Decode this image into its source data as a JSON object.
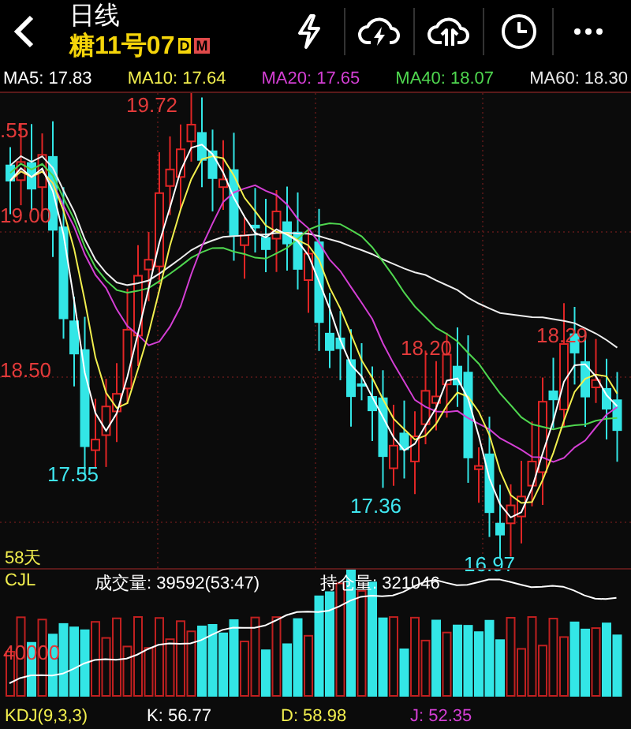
{
  "header": {
    "title": "日线",
    "symbol": "糖11号07",
    "badges": [
      {
        "text": "D",
        "color": "#f5d50a"
      },
      {
        "text": "M",
        "color": "#e04a4a"
      }
    ]
  },
  "toolbar": [
    {
      "kind": "flash"
    },
    {
      "kind": "cloud-flash"
    },
    {
      "kind": "cloud-upload"
    },
    {
      "kind": "clock"
    },
    {
      "kind": "more"
    }
  ],
  "ma_row": [
    {
      "text": "MA5: 17.83",
      "color": "#ffffff"
    },
    {
      "text": "MA10: 17.64",
      "color": "#f2ef4e"
    },
    {
      "text": "MA20: 17.65",
      "color": "#d43fd4"
    },
    {
      "text": "MA40: 18.07",
      "color": "#4fd64f"
    },
    {
      "text": "MA60: 18.30",
      "color": "#e8e8e8"
    }
  ],
  "price_axis": [
    {
      "text": ".55",
      "color": "#e23a3a"
    },
    {
      "text": "19.00",
      "color": "#e23a3a"
    },
    {
      "text": "18.50",
      "color": "#e23a3a"
    }
  ],
  "extremes": [
    {
      "text": "19.72",
      "kind": "high"
    },
    {
      "text": "17.55",
      "kind": "low"
    },
    {
      "text": "18.20",
      "kind": "high"
    },
    {
      "text": "17.36",
      "kind": "low"
    },
    {
      "text": "18.29",
      "kind": "high"
    },
    {
      "text": "16.97",
      "kind": "low"
    }
  ],
  "period": "58天",
  "volume_pane": {
    "name": "CJL",
    "volume": "成交量: 39592(53:47)",
    "open_interest": "持仓量: 321046",
    "axis_label": "40000"
  },
  "kdj": [
    {
      "text": "KDJ(9,3,3)",
      "color": "#f2ef4e"
    },
    {
      "text": "K: 56.77",
      "color": "#ffffff"
    },
    {
      "text": "D: 58.98",
      "color": "#f2ef4e"
    },
    {
      "text": "J: 52.35",
      "color": "#d43fd4"
    }
  ]
}
